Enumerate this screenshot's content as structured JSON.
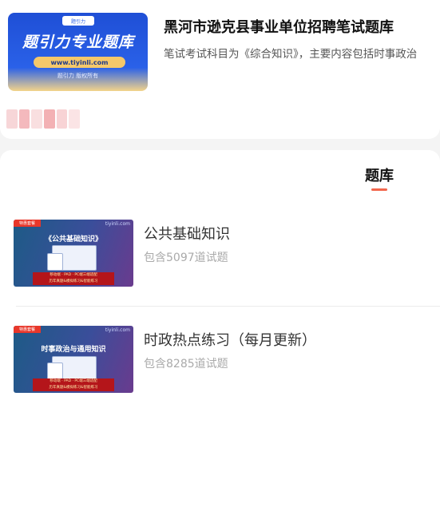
{
  "header_card": {
    "cover": {
      "logo_text": "题引力",
      "brand_text": "题引力专业题库",
      "url_text": "www.tiyinli.com",
      "copyright_text": "题引力 版权所有",
      "colors": {
        "primary": "#2a61e8",
        "accent": "#f5c86a"
      }
    },
    "title": "黑河市逊克县事业单位招聘笔试题库",
    "description": "笔试考试科目为《综合知识》，主要内容包括时事政治"
  },
  "tabs": {
    "active_label": "题库",
    "accent_color": "#f2664c"
  },
  "question_banks": [
    {
      "thumb": {
        "tag": "特惠套餐",
        "site": "tiyinli.com",
        "caption": "《公共基础知识》",
        "banner_line1": "移动端 · PAD · PC端三端适配",
        "banner_line2": "历年真题&模拟练习&智能练习"
      },
      "title": "公共基础知识",
      "count": "包含5097道试题"
    },
    {
      "thumb": {
        "tag": "特惠套餐",
        "site": "tiyinli.com",
        "caption": "时事政治与通用知识",
        "banner_line1": "移动端 · PAD · PC端三端适配",
        "banner_line2": "历年真题&模拟练习&智能练习"
      },
      "title": "时政热点练习（每月更新）",
      "count": "包含8285道试题"
    }
  ]
}
